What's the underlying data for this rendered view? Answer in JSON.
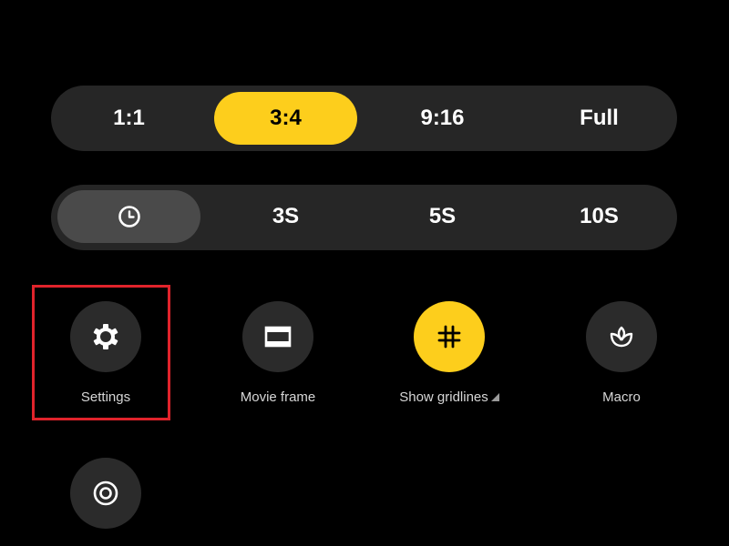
{
  "aspect_ratio": {
    "options": [
      "1:1",
      "3:4",
      "9:16",
      "Full"
    ],
    "selected": "3:4"
  },
  "timer": {
    "options": [
      "timer-off-icon",
      "3S",
      "5S",
      "10S"
    ],
    "labels": {
      "s1": "3S",
      "s2": "5S",
      "s3": "10S"
    },
    "selected": "timer-off-icon"
  },
  "tiles": {
    "settings": {
      "label": "Settings",
      "icon": "gear-icon",
      "active": false
    },
    "movie_frame": {
      "label": "Movie frame",
      "icon": "movie-frame-icon",
      "active": false
    },
    "gridlines": {
      "label": "Show gridlines",
      "icon": "grid-icon",
      "active": true
    },
    "macro": {
      "label": "Macro",
      "icon": "macro-flower-icon",
      "active": false
    },
    "extra": {
      "label": "",
      "icon": "target-icon",
      "active": false
    }
  },
  "highlight": {
    "target": "Settings",
    "color": "#e0232b"
  },
  "colors": {
    "background": "#000000",
    "bar": "#262626",
    "accent": "#fdce1c",
    "tile": "#2b2b2b",
    "selected_gray": "#4a4a4a"
  }
}
